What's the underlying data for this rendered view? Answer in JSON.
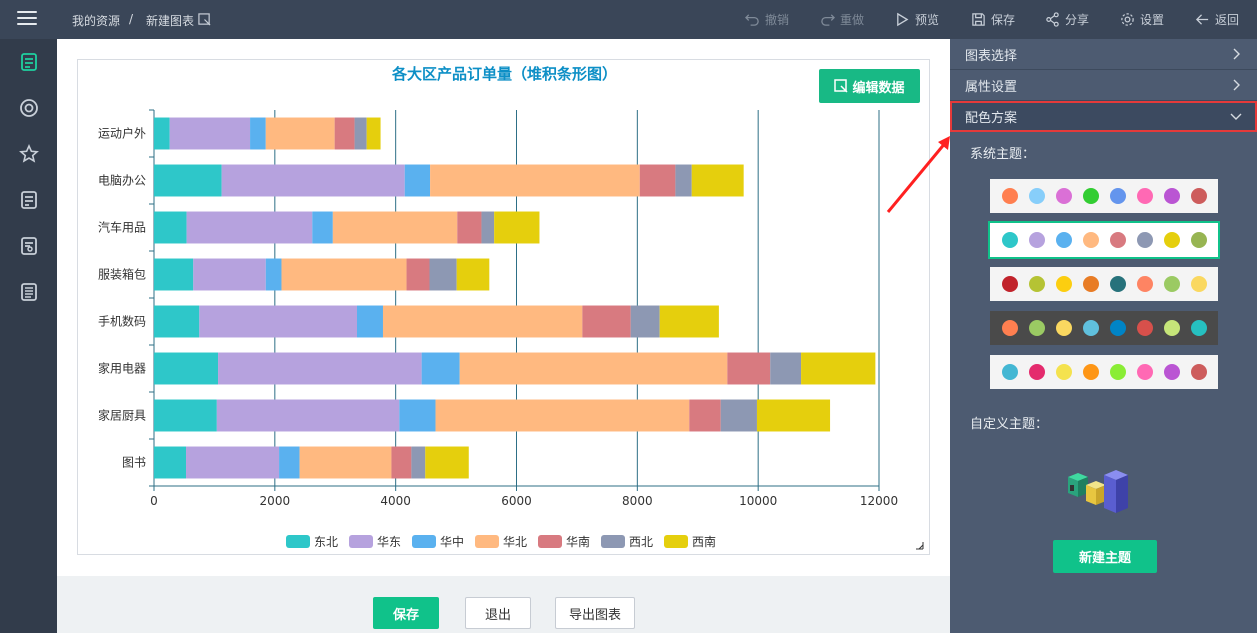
{
  "topbar": {
    "breadcrumb_root": "我的资源",
    "breadcrumb_sep": "/",
    "breadcrumb_current": "新建图表",
    "undo": "撤销",
    "redo": "重做",
    "preview": "预览",
    "save": "保存",
    "share": "分享",
    "settings": "设置",
    "back": "返回"
  },
  "sidebar": {
    "items": [
      {
        "icon": "chart-file-icon",
        "active": true
      },
      {
        "icon": "target-icon",
        "active": false
      },
      {
        "icon": "star-icon",
        "active": false
      },
      {
        "icon": "document-icon",
        "active": false
      },
      {
        "icon": "document-search-icon",
        "active": false
      },
      {
        "icon": "document-list-icon",
        "active": false
      }
    ]
  },
  "main": {
    "edit_data_label": "编辑数据",
    "save_label": "保存",
    "exit_label": "退出",
    "export_label": "导出图表"
  },
  "right_panel": {
    "chart_select": "图表选择",
    "property_settings": "属性设置",
    "color_scheme": "配色方案",
    "system_themes_label": "系统主题：",
    "custom_theme_label": "自定义主题：",
    "new_theme_label": "新建主题",
    "themes": [
      {
        "bg": "#f4f4f4",
        "colors": [
          "#ff7f50",
          "#87cefa",
          "#da70d6",
          "#32cd32",
          "#6495ed",
          "#ff69b4",
          "#ba55d3",
          "#cd5c5c"
        ]
      },
      {
        "bg": "#ffffff",
        "colors": [
          "#2ec7c9",
          "#b6a2de",
          "#5ab1ef",
          "#ffb980",
          "#d87a80",
          "#8d98b3",
          "#e5cf0d",
          "#97b552"
        ],
        "selected": true
      },
      {
        "bg": "#f4f4f4",
        "colors": [
          "#c1232b",
          "#b5c334",
          "#fcce10",
          "#e87c25",
          "#27727b",
          "#fe8463",
          "#9bca63",
          "#fad860"
        ]
      },
      {
        "bg": "#4a4a4a",
        "colors": [
          "#ff7f50",
          "#9bca63",
          "#fad860",
          "#60c0dd",
          "#0084c6",
          "#d7504b",
          "#c6e579",
          "#26c0c0"
        ]
      },
      {
        "bg": "#f4f4f4",
        "colors": [
          "#44b7d3",
          "#e42b6d",
          "#f4e24e",
          "#fe9616",
          "#8aed35",
          "#ff69b4",
          "#ba55d3",
          "#cd5c5c"
        ]
      }
    ]
  },
  "chart_data": {
    "type": "bar",
    "orientation": "horizontal",
    "stacked": true,
    "title": "各大区产品订单量（堆积条形图）",
    "categories": [
      "运动户外",
      "电脑办公",
      "汽车用品",
      "服装箱包",
      "手机数码",
      "家用电器",
      "家居厨具",
      "图书"
    ],
    "series": [
      {
        "name": "东北",
        "color": "#2ec7c9",
        "values": [
          260,
          1120,
          540,
          650,
          750,
          1060,
          1040,
          530
        ]
      },
      {
        "name": "华东",
        "color": "#b6a2de",
        "values": [
          1330,
          3030,
          2080,
          1200,
          2610,
          3370,
          3020,
          1540
        ]
      },
      {
        "name": "华中",
        "color": "#5ab1ef",
        "values": [
          260,
          420,
          340,
          260,
          430,
          630,
          600,
          340
        ]
      },
      {
        "name": "华北",
        "color": "#ffb980",
        "values": [
          1140,
          3470,
          2060,
          2070,
          3300,
          4430,
          4200,
          1520
        ]
      },
      {
        "name": "华南",
        "color": "#d87a80",
        "values": [
          330,
          590,
          400,
          380,
          800,
          710,
          520,
          330
        ]
      },
      {
        "name": "西北",
        "color": "#8d98b3",
        "values": [
          200,
          270,
          210,
          450,
          480,
          510,
          600,
          230
        ]
      },
      {
        "name": "西南",
        "color": "#e5cf0d",
        "values": [
          230,
          860,
          750,
          540,
          980,
          1230,
          1210,
          720
        ]
      }
    ],
    "xlim": [
      0,
      12000
    ],
    "xticks": [
      0,
      2000,
      4000,
      6000,
      8000,
      10000,
      12000
    ],
    "legend_position": "bottom-center",
    "grid": true
  }
}
